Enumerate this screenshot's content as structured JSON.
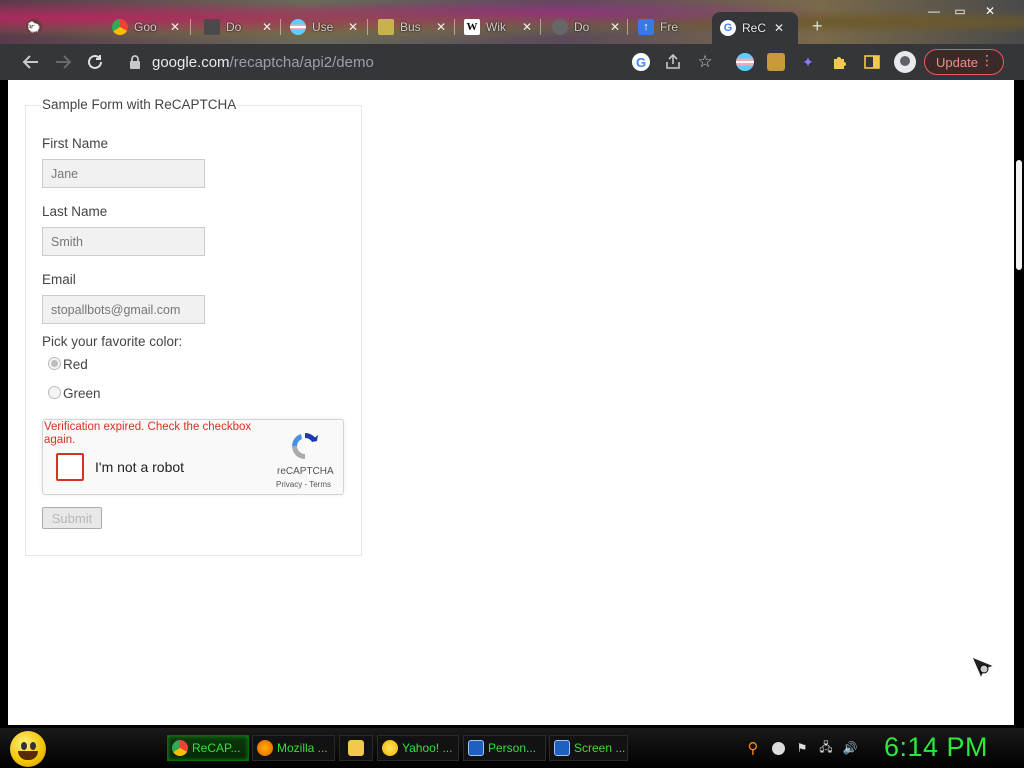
{
  "browser": {
    "tabs": [
      {
        "label": "Goo",
        "icon": "chrome-icon"
      },
      {
        "label": "Do",
        "icon": "doc-icon"
      },
      {
        "label": "Use",
        "icon": "flag-icon"
      },
      {
        "label": "Bus",
        "icon": "bus-icon"
      },
      {
        "label": "Wik",
        "icon": "wikipedia-icon"
      },
      {
        "label": "Do",
        "icon": "globe-icon"
      },
      {
        "label": "Fre",
        "icon": "arrow-icon"
      },
      {
        "label": "ReC",
        "icon": "google-icon",
        "active": true
      }
    ],
    "new_tab": "+",
    "window": {
      "minimize": "—",
      "maximize": "▭",
      "close": "✕"
    },
    "url_host": "google.com",
    "url_path": "/recaptcha/api2/demo",
    "update_label": "Update",
    "update_menu": "⋮"
  },
  "form": {
    "legend": "Sample Form with ReCAPTCHA",
    "first_name_label": "First Name",
    "first_name_value": "Jane",
    "last_name_label": "Last Name",
    "last_name_value": "Smith",
    "email_label": "Email",
    "email_value": "stopallbots@gmail.com",
    "color_label": "Pick your favorite color:",
    "colors": [
      {
        "label": "Red",
        "checked": true
      },
      {
        "label": "Green",
        "checked": false
      }
    ],
    "submit_label": "Submit"
  },
  "recaptcha": {
    "error": "Verification expired. Check the checkbox again.",
    "checkbox_label": "I'm not a robot",
    "brand": "reCAPTCHA",
    "privacy": "Privacy",
    "separator": " - ",
    "terms": "Terms"
  },
  "taskbar": {
    "items": [
      {
        "label": "ReCAP...",
        "icon": "chrome-icon",
        "active": true
      },
      {
        "label": "Mozilla ...",
        "icon": "firefox-icon"
      },
      {
        "label": "",
        "icon": "folder-icon"
      },
      {
        "label": "Yahoo! ...",
        "icon": "smiley-icon"
      },
      {
        "label": "Person...",
        "icon": "monitor-icon"
      },
      {
        "label": "Screen ...",
        "icon": "monitor-icon"
      }
    ],
    "clock": "6:14 PM"
  },
  "colors": {
    "accent_error": "#d93025",
    "taskbar_text": "#3ddc40",
    "clock": "#2ee83a"
  }
}
